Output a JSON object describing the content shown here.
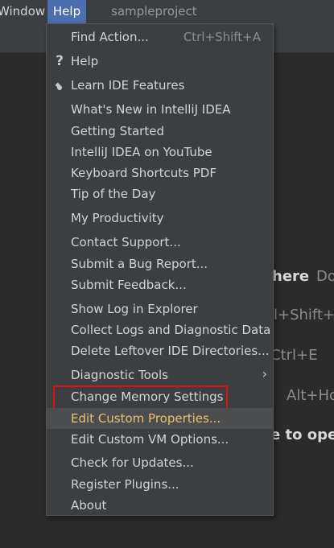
{
  "menubar": {
    "window_label": "Window",
    "help_label": "Help",
    "project_name": "sampleproject"
  },
  "editor_hints": {
    "search_action": "here",
    "search_shortcut": "Do",
    "goto_shortcut": "l+Shift+",
    "recent_shortcut": "Ctrl+E",
    "nav_shortcut": "Alt+Ho",
    "drop_text": "e to oper"
  },
  "help_menu": {
    "items": [
      {
        "label": "Find Action...",
        "shortcut": "Ctrl+Shift+A"
      },
      {
        "label": "Help",
        "icon": "question-mark-icon"
      },
      {
        "label": "Learn IDE Features",
        "icon": "graduation-cap-icon"
      },
      {
        "label": "What's New in IntelliJ IDEA"
      },
      {
        "label": "Getting Started"
      },
      {
        "label": "IntelliJ IDEA on YouTube"
      },
      {
        "label": "Keyboard Shortcuts PDF"
      },
      {
        "label": "Tip of the Day"
      },
      {
        "label": "My Productivity"
      },
      {
        "label": "Contact Support..."
      },
      {
        "label": "Submit a Bug Report..."
      },
      {
        "label": "Submit Feedback..."
      },
      {
        "label": "Show Log in Explorer"
      },
      {
        "label": "Collect Logs and Diagnostic Data"
      },
      {
        "label": "Delete Leftover IDE Directories..."
      },
      {
        "label": "Diagnostic Tools",
        "has_submenu": true
      },
      {
        "label": "Change Memory Settings",
        "highlighted": true
      },
      {
        "label": "Edit Custom Properties...",
        "hovered": true
      },
      {
        "label": "Edit Custom VM Options..."
      },
      {
        "label": "Check for Updates..."
      },
      {
        "label": "Register Plugins..."
      },
      {
        "label": "About"
      }
    ],
    "submenu_arrow": "›"
  },
  "colors": {
    "menubar_bg": "#3c3f41",
    "selected_menu_bg": "#4b6eaf",
    "menu_bg": "#3c3f41",
    "hover_text": "#e8c46a",
    "highlight_border": "#e01010",
    "editor_bg": "#2b2b2b"
  }
}
